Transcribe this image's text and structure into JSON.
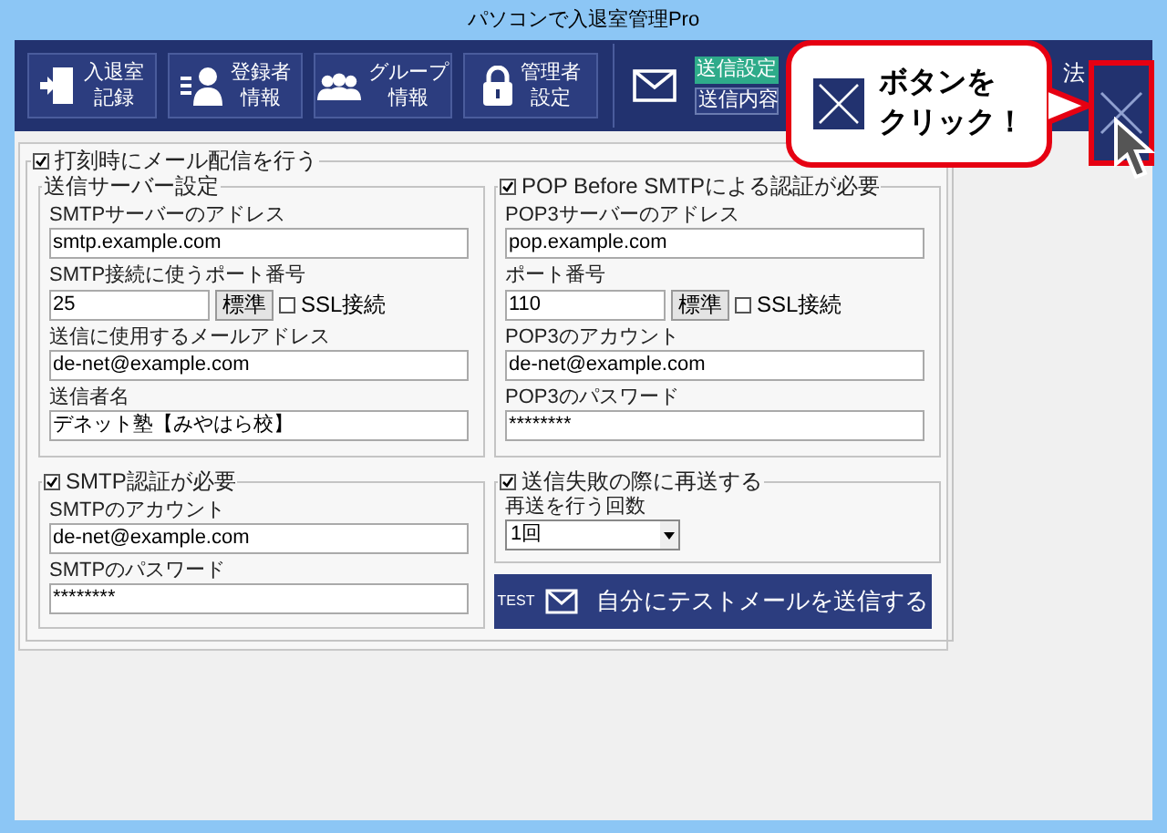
{
  "window": {
    "title": "パソコンで入退室管理Pro"
  },
  "toolbar": {
    "buttons": [
      {
        "kind": "door",
        "lines": [
          "入退室",
          "記録"
        ]
      },
      {
        "kind": "person",
        "lines": [
          "登録者",
          "情報"
        ]
      },
      {
        "kind": "group",
        "lines": [
          "グループ",
          "情報"
        ]
      },
      {
        "kind": "lock",
        "lines": [
          "管理者",
          "設定"
        ]
      }
    ],
    "mail_tabs": [
      {
        "label": "送信設定",
        "selected": true
      },
      {
        "label": "送信内容",
        "selected": false
      }
    ],
    "partial_label": "法"
  },
  "callout": {
    "lines": [
      "ボタンを",
      "クリック！"
    ]
  },
  "form": {
    "enable": {
      "label": "打刻時にメール配信を行う",
      "checked": true
    },
    "server": {
      "title": "送信サーバー設定",
      "fields": [
        {
          "kind": "text",
          "label": "SMTPサーバーのアドレス",
          "value": "smtp.example.com"
        },
        {
          "kind": "port",
          "label": "SMTP接続に使うポート番号",
          "value": "25",
          "button": "標準",
          "ssl_label": "SSL接続",
          "ssl_checked": false
        },
        {
          "kind": "text",
          "label": "送信に使用するメールアドレス",
          "value": "de-net@example.com"
        },
        {
          "kind": "text",
          "label": "送信者名",
          "value": "デネット塾【みやはら校】"
        }
      ]
    },
    "pop": {
      "title": "POP Before SMTPによる認証が必要",
      "checked": true,
      "fields": [
        {
          "kind": "text",
          "label": "POP3サーバーのアドレス",
          "value": "pop.example.com"
        },
        {
          "kind": "port",
          "label": "ポート番号",
          "value": "110",
          "button": "標準",
          "ssl_label": "SSL接続",
          "ssl_checked": false
        },
        {
          "kind": "text",
          "label": "POP3のアカウント",
          "value": "de-net@example.com"
        },
        {
          "kind": "text",
          "label": "POP3のパスワード",
          "value": "********"
        }
      ]
    },
    "auth": {
      "title": "SMTP認証が必要",
      "checked": true,
      "fields": [
        {
          "kind": "text",
          "label": "SMTPのアカウント",
          "value": "de-net@example.com"
        },
        {
          "kind": "text",
          "label": "SMTPのパスワード",
          "value": "********"
        }
      ]
    },
    "retry": {
      "title": "送信失敗の際に再送する",
      "checked": true,
      "label": "再送を行う回数",
      "value": "1回"
    },
    "test_button": {
      "badge": "TEST",
      "label": "自分にテストメールを送信する"
    }
  }
}
